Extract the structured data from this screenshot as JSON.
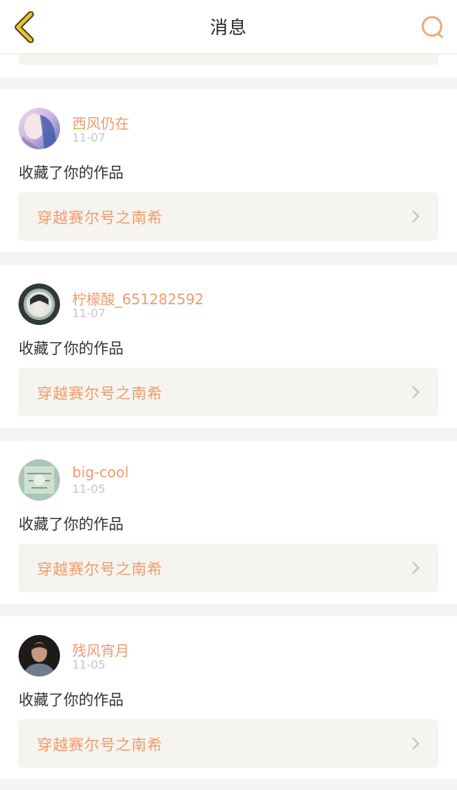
{
  "header": {
    "title": "消息",
    "back_icon": "chevron-left-icon",
    "search_icon": "search-icon",
    "accent": "#e8c23a",
    "search_color": "#f0a77f"
  },
  "messages": [
    {
      "name": "西风仍在",
      "date": "11-07",
      "action": "收藏了你的作品",
      "work_title": "穿越赛尔号之南希",
      "avatar": "avatar-image"
    },
    {
      "name": "柠檬酸_651282592",
      "date": "11-07",
      "action": "收藏了你的作品",
      "work_title": "穿越赛尔号之南希",
      "avatar": "avatar-image"
    },
    {
      "name": "big-cool",
      "date": "11-05",
      "action": "收藏了你的作品",
      "work_title": "穿越赛尔号之南希",
      "avatar": "avatar-image"
    },
    {
      "name": "残风宵月",
      "date": "11-05",
      "action": "收藏了你的作品",
      "work_title": "穿越赛尔号之南希",
      "avatar": "avatar-image"
    }
  ],
  "colors": {
    "name": "#ef9b6d",
    "date": "#c5c5c5",
    "link_bg": "#f6f4ee",
    "page_bg": "#f6f4f2"
  }
}
